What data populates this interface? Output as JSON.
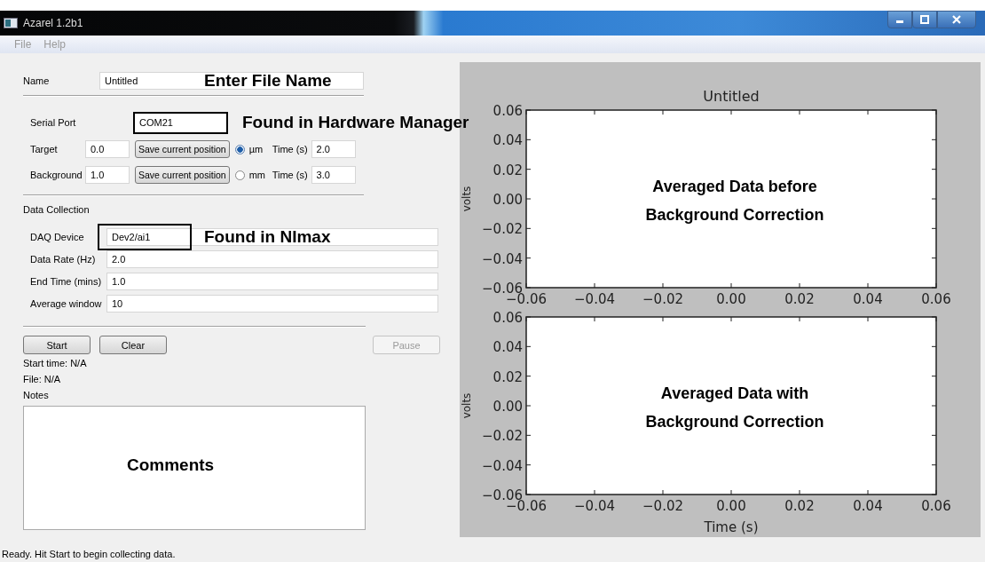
{
  "window": {
    "title": "Azarel 1.2b1"
  },
  "menu": [
    "File",
    "Help"
  ],
  "name_field": {
    "label": "Name",
    "value": "Untitled",
    "highlighted": false,
    "annotation": "Enter File Name"
  },
  "serial_port": {
    "label": "Serial Port",
    "value": "COM21",
    "highlighted": true,
    "annotation": "Found in Hardware Manager"
  },
  "positions": [
    {
      "label": "Target",
      "value": "0.0",
      "button": "Save current position",
      "unit": "µm",
      "selected": true,
      "time_label": "Time (s)",
      "time": "2.0"
    },
    {
      "label": "Background",
      "value": "1.0",
      "button": "Save current position",
      "unit": "mm",
      "selected": false,
      "time_label": "Time (s)",
      "time": "3.0"
    }
  ],
  "data_collection": {
    "heading": "Data Collection",
    "fields": [
      {
        "label": "DAQ Device",
        "value": "Dev2/ai1",
        "highlighted": true,
        "annotation": "Found in NImax"
      },
      {
        "label": "Data Rate (Hz)",
        "value": "2.0",
        "highlighted": false
      },
      {
        "label": "End Time (mins)",
        "value": "1.0",
        "highlighted": false
      },
      {
        "label": "Average window",
        "value": "10",
        "highlighted": false
      }
    ]
  },
  "buttons": [
    {
      "label": "Start",
      "disabled": false
    },
    {
      "label": "Clear",
      "disabled": false
    },
    {
      "label": "Pause",
      "disabled": true
    }
  ],
  "start_time": "Start time: N/A",
  "file": "File: N/A",
  "notes": {
    "label": "Notes",
    "annotation": "Comments"
  },
  "plots": [
    {
      "chart_data": {
        "type": "line",
        "title": "Untitled",
        "ylabel": "volts",
        "xlim": [
          -0.06,
          0.06
        ],
        "ylim": [
          -0.06,
          0.06
        ],
        "xticks": [
          {
            "value": -0.06,
            "label": "−0.06"
          },
          {
            "value": -0.04,
            "label": "−0.04"
          },
          {
            "value": -0.02,
            "label": "−0.02"
          },
          {
            "value": 0,
            "label": "0.00"
          },
          {
            "value": 0.02,
            "label": "0.02"
          },
          {
            "value": 0.04,
            "label": "0.04"
          },
          {
            "value": 0.06,
            "label": "0.06"
          }
        ],
        "yticks": [
          {
            "value": -0.06,
            "label": "−0.06"
          },
          {
            "value": -0.04,
            "label": "−0.04"
          },
          {
            "value": -0.02,
            "label": "−0.02"
          },
          {
            "value": 0,
            "label": "0.00"
          },
          {
            "value": 0.02,
            "label": "0.02"
          },
          {
            "value": 0.04,
            "label": "0.04"
          },
          {
            "value": 0.06,
            "label": "0.06"
          }
        ],
        "annotations": [
          "Averaged Data before Background Correction"
        ]
      }
    },
    {
      "chart_data": {
        "type": "line",
        "xlabel": "Time (s)",
        "ylabel": "volts",
        "xlim": [
          -0.06,
          0.06
        ],
        "ylim": [
          -0.06,
          0.06
        ],
        "xticks": [
          {
            "value": -0.06,
            "label": "−0.06"
          },
          {
            "value": -0.04,
            "label": "−0.04"
          },
          {
            "value": -0.02,
            "label": "−0.02"
          },
          {
            "value": 0,
            "label": "0.00"
          },
          {
            "value": 0.02,
            "label": "0.02"
          },
          {
            "value": 0.04,
            "label": "0.04"
          },
          {
            "value": 0.06,
            "label": "0.06"
          }
        ],
        "yticks": [
          {
            "value": -0.06,
            "label": "−0.06"
          },
          {
            "value": -0.04,
            "label": "−0.04"
          },
          {
            "value": -0.02,
            "label": "−0.02"
          },
          {
            "value": 0,
            "label": "0.00"
          },
          {
            "value": 0.02,
            "label": "0.02"
          },
          {
            "value": 0.04,
            "label": "0.04"
          },
          {
            "value": 0.06,
            "label": "0.06"
          }
        ],
        "annotations": [
          "Averaged Data with Background Correction"
        ]
      }
    }
  ],
  "status_bar": "Ready.  Hit Start to begin collecting data."
}
